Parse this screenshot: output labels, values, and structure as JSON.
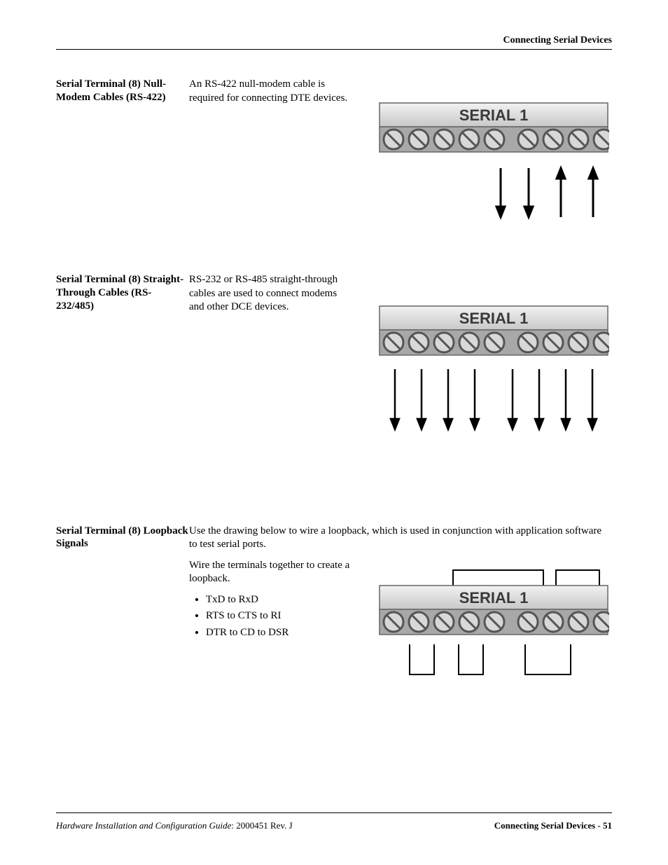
{
  "header": {
    "title": "Connecting Serial Devices"
  },
  "sections": {
    "s1": {
      "heading": "Serial Terminal (8) Null-Modem Cables (RS-422)",
      "body": "An RS-422 null-modem cable is required for connecting DTE devices.",
      "diagram_label": "SERIAL 1"
    },
    "s2": {
      "heading": "Serial Terminal (8) Straight-Through Cables (RS-232/485)",
      "body": "RS-232 or RS-485 straight-through cables are used to connect modems and other DCE devices.",
      "diagram_label": "SERIAL 1"
    },
    "s3": {
      "heading": "Serial Terminal (8) Loopback Signals",
      "intro": "Use the drawing below to wire a loopback, which is used in conjunction with application software to test serial ports.",
      "body": "Wire the terminals together to create a loopback.",
      "bullets": {
        "b1": "TxD to RxD",
        "b2": "RTS to CTS to RI",
        "b3": "DTR to CD to DSR"
      },
      "diagram_label": "SERIAL 1"
    }
  },
  "footer": {
    "guide_title": "Hardware Installation and Configuration Guide",
    "doc_info": ": 2000451 Rev. J",
    "page_label": "Connecting Serial Devices - 51"
  }
}
